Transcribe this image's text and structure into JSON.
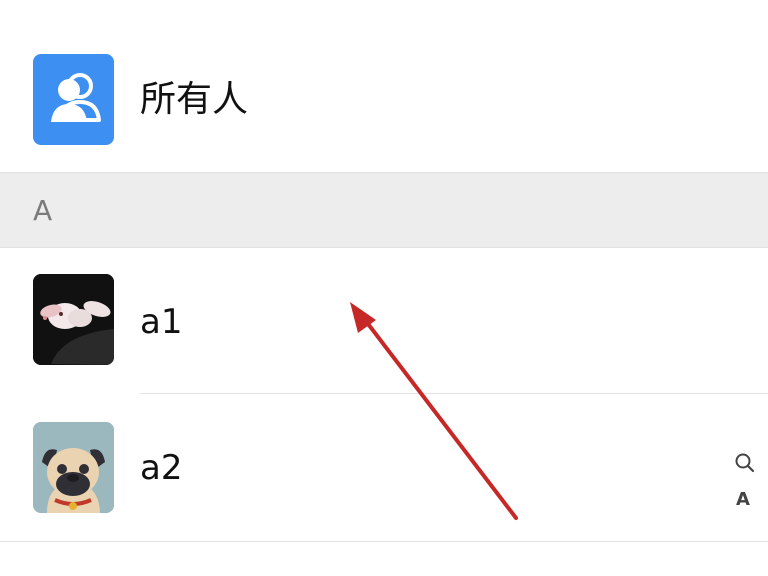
{
  "contacts": {
    "everyone": {
      "label": "所有人",
      "icon": "group-icon",
      "accent": "#3d8ff1"
    },
    "sections": [
      {
        "letter": "A",
        "items": [
          {
            "name": "a1",
            "avatar": "rabbit-avatar"
          },
          {
            "name": "a2",
            "avatar": "pug-avatar"
          }
        ]
      }
    ]
  },
  "index_bar": {
    "search_icon": "search-icon",
    "letter": "A"
  },
  "annotation": {
    "icon": "arrow-icon",
    "color": "#c62828"
  }
}
